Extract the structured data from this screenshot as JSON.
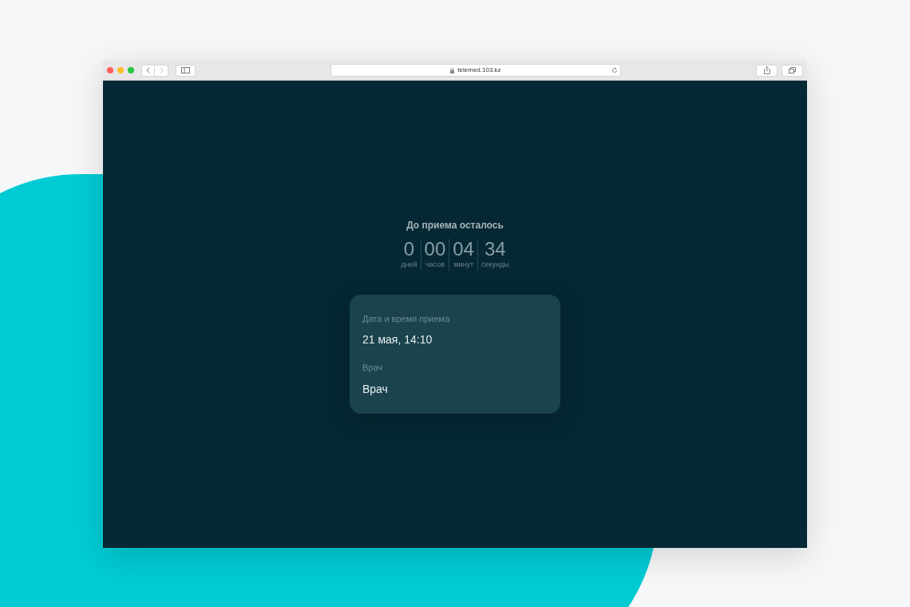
{
  "browser": {
    "url": "telemed.103.kz"
  },
  "countdown": {
    "title": "До приема осталось",
    "units": [
      {
        "value": "0",
        "label": "дней"
      },
      {
        "value": "00",
        "label": "часов"
      },
      {
        "value": "04",
        "label": "минут"
      },
      {
        "value": "34",
        "label": "секунды"
      }
    ]
  },
  "appointment_card": {
    "fields": [
      {
        "label": "Дата и время приема",
        "value": "21 мая, 14:10"
      },
      {
        "label": "Врач",
        "value": "Врач"
      }
    ]
  }
}
